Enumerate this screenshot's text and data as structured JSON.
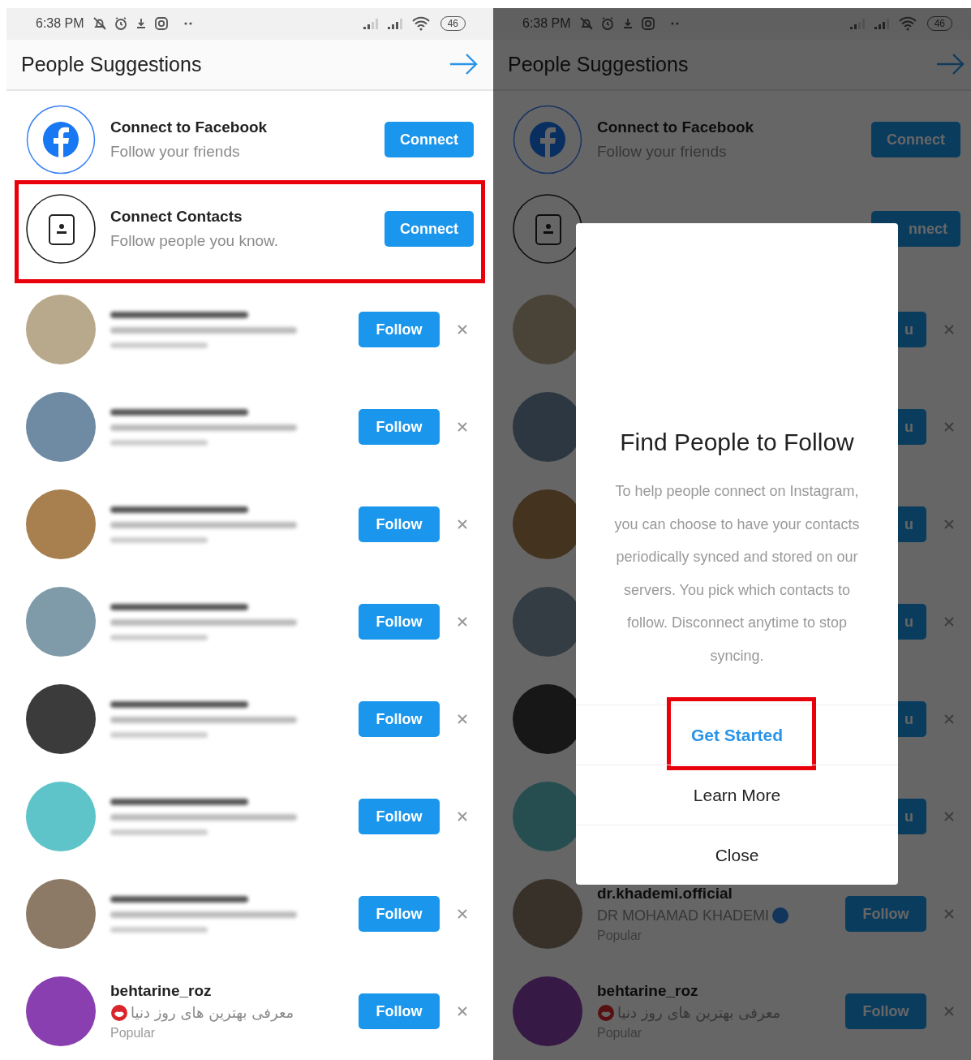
{
  "screens": [
    {
      "status_bar": {
        "time": "6:38 PM",
        "battery": "46"
      },
      "header": {
        "title": "People Suggestions"
      },
      "connect_rows": [
        {
          "kind": "facebook",
          "title": "Connect to Facebook",
          "subtitle": "Follow your friends",
          "button": "Connect",
          "highlighted": false
        },
        {
          "kind": "contacts",
          "title": "Connect Contacts",
          "subtitle": "Follow people you know.",
          "button": "Connect",
          "highlighted": true
        }
      ],
      "suggestions": [
        {
          "kind": "blurred",
          "button": "Follow"
        },
        {
          "kind": "blurred",
          "button": "Follow"
        },
        {
          "kind": "blurred",
          "button": "Follow"
        },
        {
          "kind": "blurred",
          "button": "Follow"
        },
        {
          "kind": "blurred",
          "button": "Follow"
        },
        {
          "kind": "blurred",
          "button": "Follow"
        },
        {
          "kind": "blurred",
          "button": "Follow"
        },
        {
          "kind": "named",
          "username": "behtarine_roz",
          "subtitle": "معرفی بهترین های روز دنیا",
          "badge": {
            "kind": "lips"
          },
          "note": "Popular",
          "button": "Follow"
        }
      ]
    },
    {
      "status_bar": {
        "time": "6:38 PM",
        "battery": "46"
      },
      "header": {
        "title": "People Suggestions"
      },
      "connect_rows": [
        {
          "kind": "facebook",
          "title": "Connect to Facebook",
          "subtitle": "Follow your friends",
          "button": "Connect",
          "highlighted": false
        },
        {
          "kind": "contacts",
          "button": "nnect",
          "highlighted": false
        }
      ],
      "suggestions": [
        {
          "kind": "covered",
          "button": "u"
        },
        {
          "kind": "covered",
          "button": "u"
        },
        {
          "kind": "covered",
          "button": "u"
        },
        {
          "kind": "covered",
          "button": "u"
        },
        {
          "kind": "covered",
          "button": "u"
        },
        {
          "kind": "covered",
          "button": "u"
        },
        {
          "kind": "named",
          "username": "dr.khademi.official",
          "subtitle": "DR MOHAMAD KHADEMI",
          "badge": {
            "kind": "verified"
          },
          "note": "Popular",
          "button": "Follow"
        },
        {
          "kind": "named",
          "username": "behtarine_roz",
          "subtitle": "معرفی بهترین های روز دنیا",
          "badge": {
            "kind": "lips"
          },
          "note": "Popular",
          "button": "Follow"
        }
      ],
      "dialog": {
        "title": "Find People to Follow",
        "body": "To help people connect on Instagram, you can choose to have your contacts periodically synced and stored on our servers. You pick which contacts to follow. Disconnect anytime to stop syncing.",
        "actions": [
          {
            "label": "Get Started",
            "kind": "primary",
            "highlighted": true
          },
          {
            "label": "Learn More",
            "kind": "plain",
            "highlighted": false
          },
          {
            "label": "Close",
            "kind": "plain",
            "highlighted": false
          }
        ]
      }
    }
  ]
}
